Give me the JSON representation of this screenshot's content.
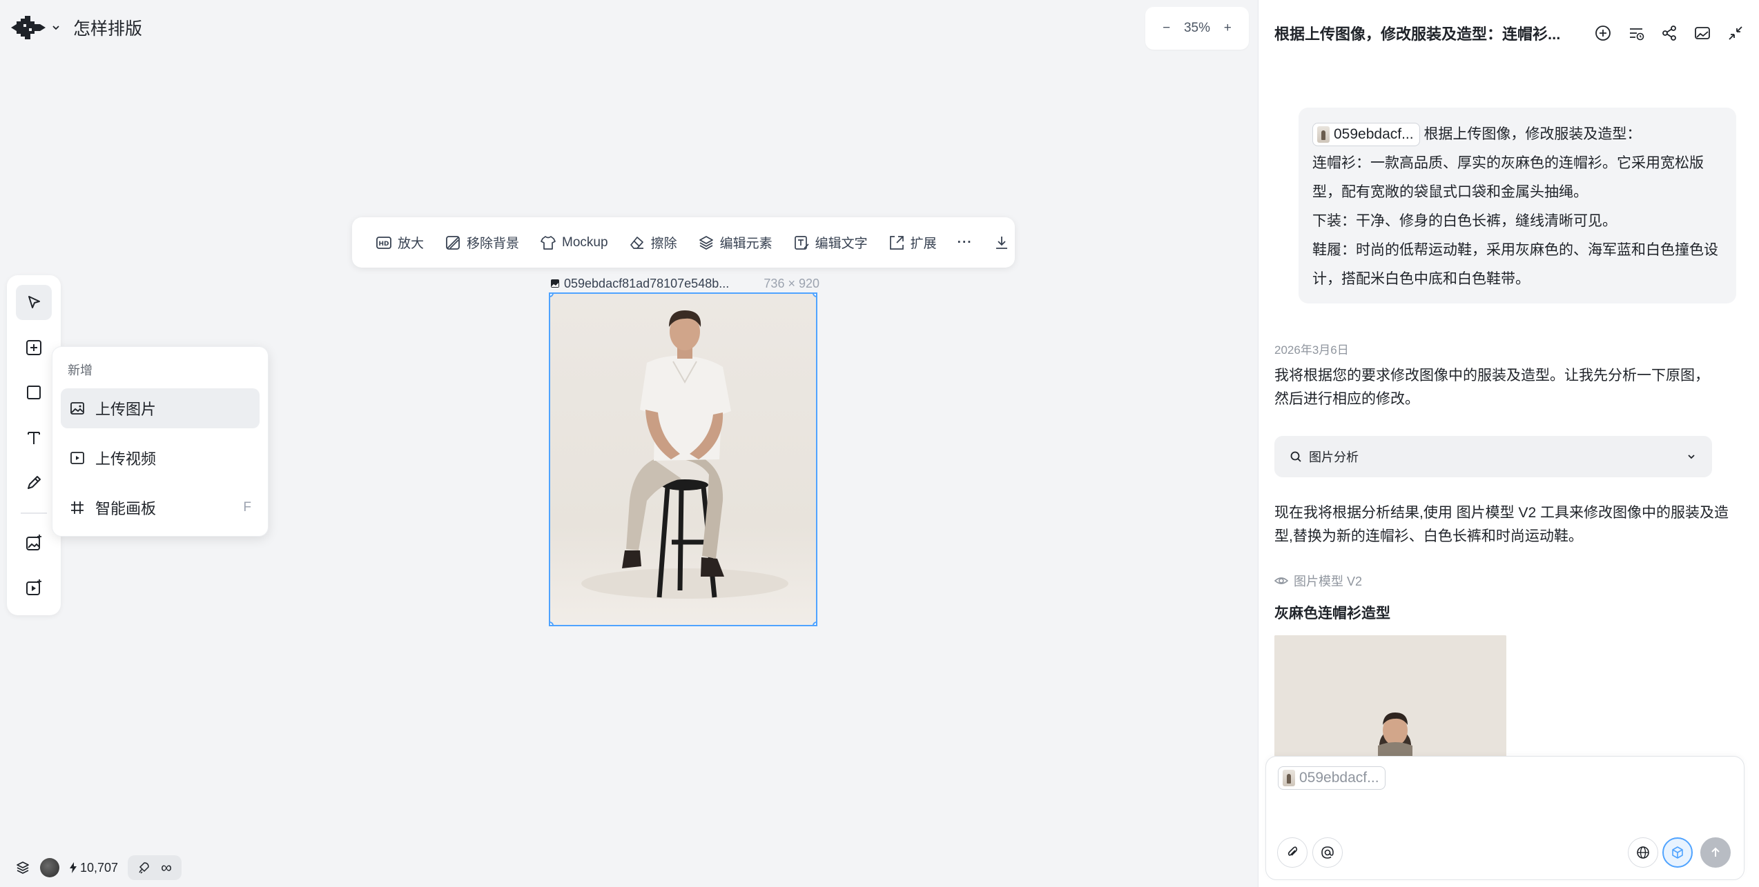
{
  "app": {
    "project_title": "怎样排版"
  },
  "zoom": {
    "minus": "−",
    "level": "35%",
    "plus": "+"
  },
  "new_menu": {
    "header": "新增",
    "items": [
      {
        "label": "上传图片",
        "shortcut": ""
      },
      {
        "label": "上传视频",
        "shortcut": ""
      },
      {
        "label": "智能画板",
        "shortcut": "F"
      }
    ]
  },
  "image_toolbar": {
    "items": [
      {
        "label": "放大",
        "icon": "hd-icon"
      },
      {
        "label": "移除背景",
        "icon": "remove-bg-icon"
      },
      {
        "label": "Mockup",
        "icon": "shirt-icon"
      },
      {
        "label": "擦除",
        "icon": "eraser-icon"
      },
      {
        "label": "编辑元素",
        "icon": "layers-icon"
      },
      {
        "label": "编辑文字",
        "icon": "edit-text-icon"
      },
      {
        "label": "扩展",
        "icon": "expand-icon"
      }
    ],
    "more": "···"
  },
  "canvas_image": {
    "filename": "059ebdacf81ad78107e548b...",
    "dimensions": "736 × 920"
  },
  "status_bar": {
    "credits": "10,707",
    "infinite": "∞"
  },
  "chat": {
    "title": "根据上传图像，修改服装及造型：连帽衫...",
    "user_message": {
      "chip": "059ebdacf...",
      "lines": [
        "根据上传图像，修改服装及造型：",
        "连帽衫：一款高品质、厚实的灰麻色的连帽衫。它采用宽松版型，配有宽敞的袋鼠式口袋和金属头抽绳。",
        "下装：干净、修身的白色长裤，缝线清晰可见。",
        "鞋履：时尚的低帮运动鞋，采用灰麻色的、海军蓝和白色撞色设计，搭配米白色中底和白色鞋带。"
      ]
    },
    "date": "2026年3月6日",
    "assistant_intro": "我将根据您的要求修改图像中的服装及造型。让我先分析一下原图，然后进行相应的修改。",
    "analysis_label": "图片分析",
    "assistant_followup": "现在我将根据分析结果,使用 图片模型 V2 工具来修改图像中的服装及造型,替换为新的连帽衫、白色长裤和时尚运动鞋。",
    "model_tag": "图片模型 V2",
    "output_title": "灰麻色连帽衫造型",
    "input_chip": "059ebdacf..."
  },
  "colors": {
    "accent": "#4fa3ff",
    "background": "#f3f4f6"
  }
}
